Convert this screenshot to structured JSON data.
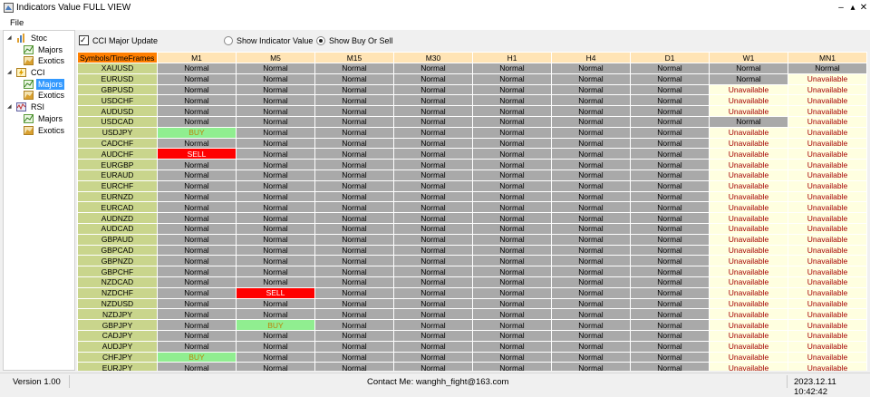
{
  "window": {
    "title": "Indicators Value FULL VIEW"
  },
  "menu": {
    "file": "File"
  },
  "tree": [
    {
      "label": "Stoc",
      "icon": "bar-chart-icon",
      "children": [
        {
          "label": "Majors",
          "icon": "line-chart-icon",
          "selected": false
        },
        {
          "label": "Exotics",
          "icon": "area-chart-icon",
          "selected": false
        }
      ]
    },
    {
      "label": "CCI",
      "icon": "lightning-icon",
      "children": [
        {
          "label": "Majors",
          "icon": "line-chart-icon",
          "selected": true
        },
        {
          "label": "Exotics",
          "icon": "area-chart-icon",
          "selected": false
        }
      ]
    },
    {
      "label": "RSI",
      "icon": "rsi-chart-icon",
      "children": [
        {
          "label": "Majors",
          "icon": "line-chart-icon",
          "selected": false
        },
        {
          "label": "Exotics",
          "icon": "area-chart-icon",
          "selected": false
        }
      ]
    }
  ],
  "controls": {
    "update_checkbox": "CCI Major Update",
    "update_checked": true,
    "radio_value": "Show Indicator Value",
    "radio_buy_sell": "Show Buy Or Sell",
    "selected_radio": "Show Buy Or Sell"
  },
  "grid": {
    "corner": "Symbols/TimeFrames",
    "timeframes": [
      "M1",
      "M5",
      "M15",
      "M30",
      "H1",
      "H4",
      "D1",
      "W1",
      "MN1"
    ],
    "rows": [
      {
        "symbol": "XAUUSD",
        "values": [
          "Normal",
          "Normal",
          "Normal",
          "Normal",
          "Normal",
          "Normal",
          "Normal",
          "Normal",
          "Normal"
        ]
      },
      {
        "symbol": "EURUSD",
        "values": [
          "Normal",
          "Normal",
          "Normal",
          "Normal",
          "Normal",
          "Normal",
          "Normal",
          "Normal",
          "Unavailable"
        ]
      },
      {
        "symbol": "GBPUSD",
        "values": [
          "Normal",
          "Normal",
          "Normal",
          "Normal",
          "Normal",
          "Normal",
          "Normal",
          "Unavailable",
          "Unavailable"
        ]
      },
      {
        "symbol": "USDCHF",
        "values": [
          "Normal",
          "Normal",
          "Normal",
          "Normal",
          "Normal",
          "Normal",
          "Normal",
          "Unavailable",
          "Unavailable"
        ]
      },
      {
        "symbol": "AUDUSD",
        "values": [
          "Normal",
          "Normal",
          "Normal",
          "Normal",
          "Normal",
          "Normal",
          "Normal",
          "Unavailable",
          "Unavailable"
        ]
      },
      {
        "symbol": "USDCAD",
        "values": [
          "Normal",
          "Normal",
          "Normal",
          "Normal",
          "Normal",
          "Normal",
          "Normal",
          "Normal",
          "Unavailable"
        ]
      },
      {
        "symbol": "USDJPY",
        "values": [
          "BUY",
          "Normal",
          "Normal",
          "Normal",
          "Normal",
          "Normal",
          "Normal",
          "Unavailable",
          "Unavailable"
        ]
      },
      {
        "symbol": "CADCHF",
        "values": [
          "Normal",
          "Normal",
          "Normal",
          "Normal",
          "Normal",
          "Normal",
          "Normal",
          "Unavailable",
          "Unavailable"
        ]
      },
      {
        "symbol": "AUDCHF",
        "values": [
          "SELL",
          "Normal",
          "Normal",
          "Normal",
          "Normal",
          "Normal",
          "Normal",
          "Unavailable",
          "Unavailable"
        ]
      },
      {
        "symbol": "EURGBP",
        "values": [
          "Normal",
          "Normal",
          "Normal",
          "Normal",
          "Normal",
          "Normal",
          "Normal",
          "Unavailable",
          "Unavailable"
        ]
      },
      {
        "symbol": "EURAUD",
        "values": [
          "Normal",
          "Normal",
          "Normal",
          "Normal",
          "Normal",
          "Normal",
          "Normal",
          "Unavailable",
          "Unavailable"
        ]
      },
      {
        "symbol": "EURCHF",
        "values": [
          "Normal",
          "Normal",
          "Normal",
          "Normal",
          "Normal",
          "Normal",
          "Normal",
          "Unavailable",
          "Unavailable"
        ]
      },
      {
        "symbol": "EURNZD",
        "values": [
          "Normal",
          "Normal",
          "Normal",
          "Normal",
          "Normal",
          "Normal",
          "Normal",
          "Unavailable",
          "Unavailable"
        ]
      },
      {
        "symbol": "EURCAD",
        "values": [
          "Normal",
          "Normal",
          "Normal",
          "Normal",
          "Normal",
          "Normal",
          "Normal",
          "Unavailable",
          "Unavailable"
        ]
      },
      {
        "symbol": "AUDNZD",
        "values": [
          "Normal",
          "Normal",
          "Normal",
          "Normal",
          "Normal",
          "Normal",
          "Normal",
          "Unavailable",
          "Unavailable"
        ]
      },
      {
        "symbol": "AUDCAD",
        "values": [
          "Normal",
          "Normal",
          "Normal",
          "Normal",
          "Normal",
          "Normal",
          "Normal",
          "Unavailable",
          "Unavailable"
        ]
      },
      {
        "symbol": "GBPAUD",
        "values": [
          "Normal",
          "Normal",
          "Normal",
          "Normal",
          "Normal",
          "Normal",
          "Normal",
          "Unavailable",
          "Unavailable"
        ]
      },
      {
        "symbol": "GBPCAD",
        "values": [
          "Normal",
          "Normal",
          "Normal",
          "Normal",
          "Normal",
          "Normal",
          "Normal",
          "Unavailable",
          "Unavailable"
        ]
      },
      {
        "symbol": "GBPNZD",
        "values": [
          "Normal",
          "Normal",
          "Normal",
          "Normal",
          "Normal",
          "Normal",
          "Normal",
          "Unavailable",
          "Unavailable"
        ]
      },
      {
        "symbol": "GBPCHF",
        "values": [
          "Normal",
          "Normal",
          "Normal",
          "Normal",
          "Normal",
          "Normal",
          "Normal",
          "Unavailable",
          "Unavailable"
        ]
      },
      {
        "symbol": "NZDCAD",
        "values": [
          "Normal",
          "Normal",
          "Normal",
          "Normal",
          "Normal",
          "Normal",
          "Normal",
          "Unavailable",
          "Unavailable"
        ]
      },
      {
        "symbol": "NZDCHF",
        "values": [
          "Normal",
          "SELL",
          "Normal",
          "Normal",
          "Normal",
          "Normal",
          "Normal",
          "Unavailable",
          "Unavailable"
        ]
      },
      {
        "symbol": "NZDUSD",
        "values": [
          "Normal",
          "Normal",
          "Normal",
          "Normal",
          "Normal",
          "Normal",
          "Normal",
          "Unavailable",
          "Unavailable"
        ]
      },
      {
        "symbol": "NZDJPY",
        "values": [
          "Normal",
          "Normal",
          "Normal",
          "Normal",
          "Normal",
          "Normal",
          "Normal",
          "Unavailable",
          "Unavailable"
        ]
      },
      {
        "symbol": "GBPJPY",
        "values": [
          "Normal",
          "BUY",
          "Normal",
          "Normal",
          "Normal",
          "Normal",
          "Normal",
          "Unavailable",
          "Unavailable"
        ]
      },
      {
        "symbol": "CADJPY",
        "values": [
          "Normal",
          "Normal",
          "Normal",
          "Normal",
          "Normal",
          "Normal",
          "Normal",
          "Unavailable",
          "Unavailable"
        ]
      },
      {
        "symbol": "AUDJPY",
        "values": [
          "Normal",
          "Normal",
          "Normal",
          "Normal",
          "Normal",
          "Normal",
          "Normal",
          "Unavailable",
          "Unavailable"
        ]
      },
      {
        "symbol": "CHFJPY",
        "values": [
          "BUY",
          "Normal",
          "Normal",
          "Normal",
          "Normal",
          "Normal",
          "Normal",
          "Unavailable",
          "Unavailable"
        ]
      },
      {
        "symbol": "EURJPY",
        "values": [
          "Normal",
          "Normal",
          "Normal",
          "Normal",
          "Normal",
          "Normal",
          "Normal",
          "Unavailable",
          "Unavailable"
        ]
      }
    ]
  },
  "status": {
    "version": "Version 1.00",
    "contact": "Contact Me: wanghh_fight@163.com",
    "datetime": "2023.12.11 10:42:42"
  },
  "colors": {
    "normal": "#a9a9a9",
    "unavailable": "#ffffe0",
    "unavailable_text": "#a40000",
    "buy": "#90ee90",
    "buy_text": "#b8860b",
    "sell": "#ff0000",
    "sell_text": "#ffffff",
    "header": "#ffe4b5",
    "corner": "#ff7f00",
    "symbol_cell": "#c9d58c",
    "tree_selected": "#3399ff"
  }
}
